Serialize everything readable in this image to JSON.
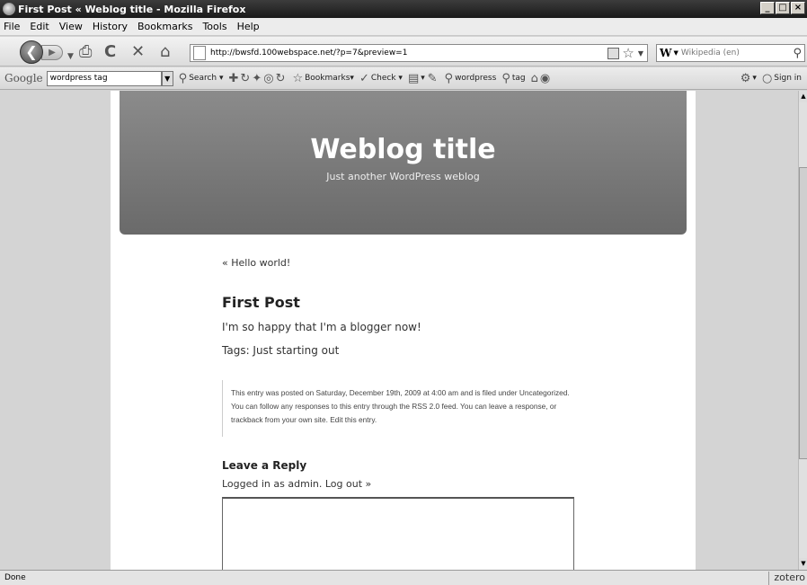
{
  "window": {
    "title": "First Post « Weblog title - Mozilla Firefox",
    "controls": [
      "_",
      "□",
      "×"
    ]
  },
  "menubar": {
    "items": [
      "File",
      "Edit",
      "View",
      "History",
      "Bookmarks",
      "Tools",
      "Help"
    ]
  },
  "navbar": {
    "url": "http://bwsfd.100webspace.net/?p=7&preview=1",
    "search_engine": "W",
    "search_placeholder": "Wikipedia (en)"
  },
  "googlebar": {
    "logo": "Google",
    "query": "wordpress tag",
    "search_label": "Search",
    "bookmarks_label": "Bookmarks",
    "check_label": "Check",
    "tag1": "wordpress",
    "tag2": "tag",
    "signin_label": "Sign in"
  },
  "blog": {
    "title": "Weblog title",
    "tagline": "Just another WordPress weblog",
    "prev_link": "« Hello world!",
    "post_title": "First Post",
    "post_body": "I'm so happy that I'm a blogger now!",
    "post_tags": "Tags: Just starting out",
    "postmeta": "This entry was posted on Saturday, December 19th, 2009 at 4:00 am and is filed under Uncategorized. You can follow any responses to this entry through the RSS 2.0 feed. You can leave a response, or trackback from your own site. Edit this entry.",
    "reply_title": "Leave a Reply",
    "logged_in_prefix": "Logged in as",
    "logged_in_user": "admin.",
    "logout": "Log out »"
  },
  "statusbar": {
    "text": "Done",
    "zotero": "zotero"
  }
}
